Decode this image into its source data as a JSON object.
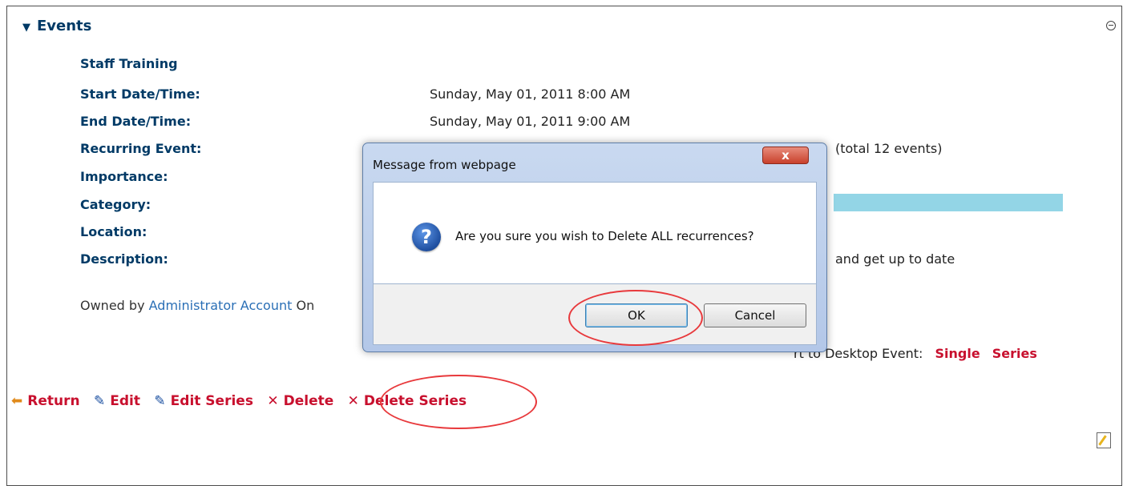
{
  "section": {
    "title": "Events"
  },
  "event": {
    "name": "Staff Training",
    "fields": [
      {
        "label": "Start Date/Time:",
        "value": "Sunday, May 01, 2011 8:00 AM"
      },
      {
        "label": "End Date/Time:",
        "value": "Sunday, May 01, 2011 9:00 AM"
      },
      {
        "label": "Recurring Event:",
        "value": "(total 12 events)"
      },
      {
        "label": "Importance:",
        "value": ""
      },
      {
        "label": "Category:",
        "value": ""
      },
      {
        "label": "Location:",
        "value": ""
      },
      {
        "label": "Description:",
        "value": "and get up to date"
      }
    ],
    "owner_prefix": "Owned by",
    "owner_name": "Administrator Account",
    "owner_suffix": "On"
  },
  "export": {
    "label": "rt to Desktop Event:",
    "single": "Single",
    "series": "Series"
  },
  "actions": {
    "return": "Return",
    "edit": "Edit",
    "edit_series": "Edit Series",
    "delete": "Delete",
    "delete_series": "Delete Series"
  },
  "dialog": {
    "title": "Message from webpage",
    "close": "x",
    "message": "Are you sure you wish to Delete ALL recurrences?",
    "ok": "OK",
    "cancel": "Cancel"
  },
  "colors": {
    "accent_red": "#c8102e",
    "label_blue": "#003a66",
    "link_blue": "#2a6fb6",
    "category_bar": "#93d5e6"
  }
}
